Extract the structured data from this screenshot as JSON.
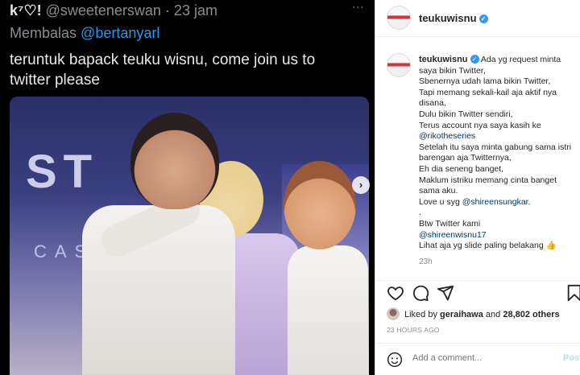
{
  "tweet": {
    "display_name": "k⁷♡!",
    "handle_time": "@sweetenerswan · 23 jam",
    "reply_prefix": "Membalas",
    "reply_to": "@bertanyarl",
    "text": "teruntuk bapack teuku wisnu, come join us to twitter please",
    "more_label": "⋮",
    "photo_stage_text": "ST",
    "photo_stage_sub": "CASE"
  },
  "post": {
    "username": "teukuwisnu",
    "verified_glyph": "✓",
    "caption_lines": [
      "Ada yg request minta saya bikin Twitter,",
      "Sbenernya udah lama bikin Twitter,",
      "Tapi memang sekali-kail aja aktif nya disana,",
      "Dulu bikin Twitter sendiri,",
      "Terus account nya saya kasih ke"
    ],
    "mention_1": "@rikotheseries",
    "caption_lines_2": [
      "Setelah itu saya minta gabung sama istri barengan aja Twitternya,",
      "Eh dia seneng banget,",
      "Maklum istriku memang cinta banget sama aku."
    ],
    "love_prefix": "Love u syg",
    "mention_2": "@shireensungkar",
    "love_suffix": ".",
    "dot_line": ".",
    "btw_line": "Btw Twitter kami",
    "mention_3": "@shireenwisnu17",
    "last_line": "Lihat aja yg slide paling belakang 👍",
    "caption_time": "23h",
    "likes_prefix": "Liked by",
    "likes_user": "geraihawa",
    "likes_and": "and",
    "likes_count": "28,802 others",
    "posted_ago": "23 HOURS AGO",
    "comment_placeholder": "Add a comment...",
    "post_label": "Post"
  },
  "icons": [
    "heart-icon",
    "comment-icon",
    "share-icon",
    "bookmark-icon",
    "emoji-icon",
    "next-arrow-icon"
  ],
  "colors": {
    "tweet_bg": "#000000",
    "mention_blue": "#1d9bf0",
    "ig_verified": "#3897f0",
    "ig_post": "#b2dffc"
  }
}
